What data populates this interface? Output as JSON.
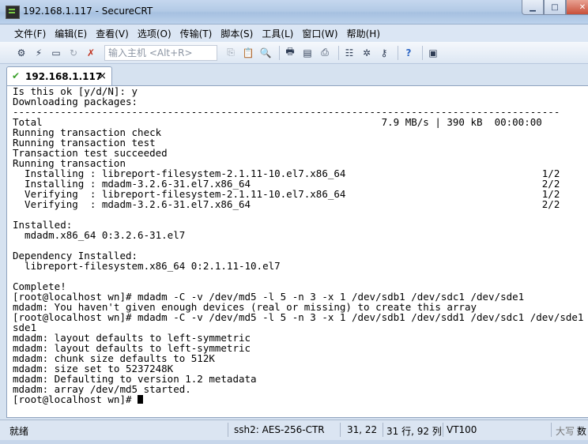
{
  "window": {
    "title": "192.168.1.117 - SecureCRT"
  },
  "menu": [
    "文件(F)",
    "编辑(E)",
    "查看(V)",
    "选项(O)",
    "传输(T)",
    "脚本(S)",
    "工具(L)",
    "窗口(W)",
    "帮助(H)"
  ],
  "toolbar": {
    "host_placeholder": "输入主机 <Alt+R>"
  },
  "tab": {
    "label": "192.168.1.117",
    "close": "×"
  },
  "terminal": {
    "lines": [
      "Is this ok [y/d/N]: y",
      "Downloading packages:",
      "--------------------------------------------------------------------------------------------",
      "Total                                                         7.9 MB/s | 390 kB  00:00:00",
      "Running transaction check",
      "Running transaction test",
      "Transaction test succeeded",
      "Running transaction",
      "  Installing : libreport-filesystem-2.1.11-10.el7.x86_64                                 1/2",
      "  Installing : mdadm-3.2.6-31.el7.x86_64                                                 2/2",
      "  Verifying  : libreport-filesystem-2.1.11-10.el7.x86_64                                 1/2",
      "  Verifying  : mdadm-3.2.6-31.el7.x86_64                                                 2/2",
      "",
      "Installed:",
      "  mdadm.x86_64 0:3.2.6-31.el7",
      "",
      "Dependency Installed:",
      "  libreport-filesystem.x86_64 0:2.1.11-10.el7",
      "",
      "Complete!",
      "[root@localhost wn]# mdadm -C -v /dev/md5 -l 5 -n 3 -x 1 /dev/sdb1 /dev/sdc1 /dev/sde1",
      "mdadm: You haven't given enough devices (real or missing) to create this array",
      "[root@localhost wn]# mdadm -C -v /dev/md5 -l 5 -n 3 -x 1 /dev/sdb1 /dev/sdd1 /dev/sdc1 /dev/sde1",
      "sde1",
      "mdadm: layout defaults to left-symmetric",
      "mdadm: layout defaults to left-symmetric",
      "mdadm: chunk size defaults to 512K",
      "mdadm: size set to 5237248K",
      "mdadm: Defaulting to version 1.2 metadata",
      "mdadm: array /dev/md5 started."
    ],
    "prompt": "[root@localhost wn]# "
  },
  "status": {
    "state": "就绪",
    "cipher": "ssh2: AES-256-CTR",
    "cursor_pos": "31,  22",
    "dims": "31 行, 92 列",
    "emulation": "VT100",
    "caps": "大写",
    "num": "数"
  }
}
